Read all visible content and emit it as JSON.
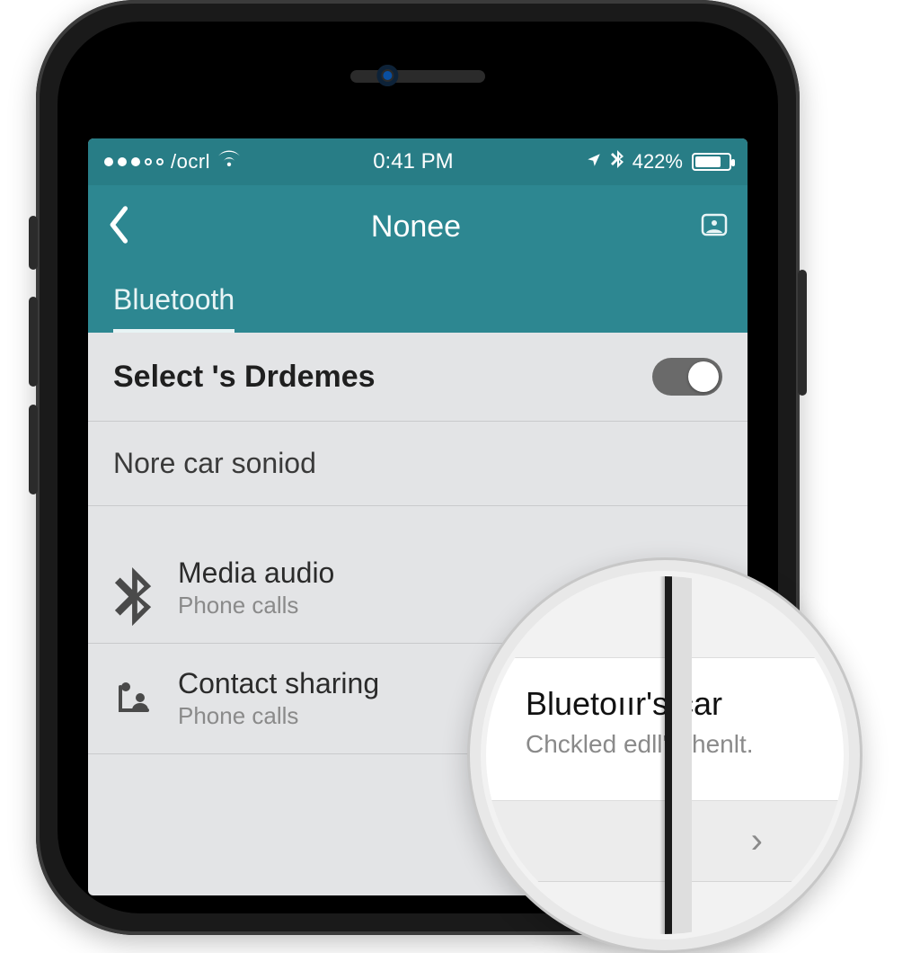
{
  "statusbar": {
    "carrier": "/ocrl",
    "time": "0:41 PM",
    "battery_text": "422%"
  },
  "nav": {
    "title": "Nonee"
  },
  "tabs": {
    "bluetooth": "Bluetooth"
  },
  "rows": {
    "select_title": "Select 's Drdemes",
    "more_title": "Nore car soniod"
  },
  "list": [
    {
      "primary": "Media audio",
      "secondary": "Phone calls"
    },
    {
      "primary": "Contact sharing",
      "secondary": "Phone calls"
    }
  ],
  "magnifier": {
    "title": "Bluetoıır's car",
    "subtitle": "Chckled edll'pl'henlt.",
    "chevron": "›"
  }
}
